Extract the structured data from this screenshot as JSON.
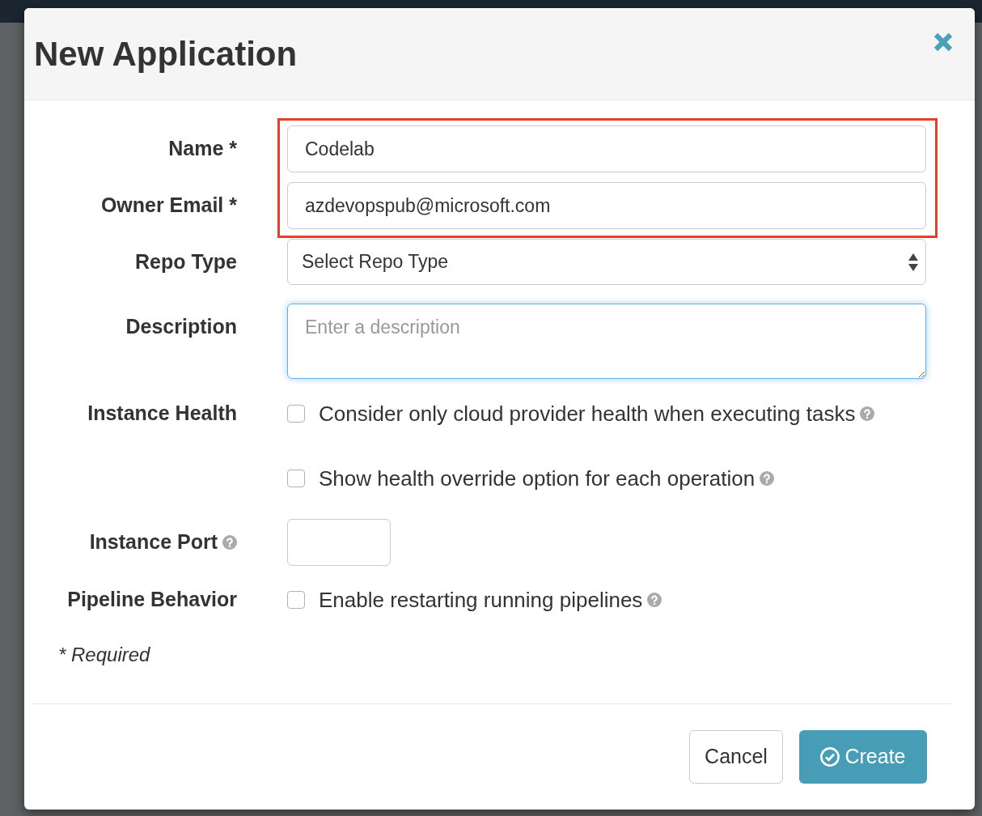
{
  "dialog": {
    "title": "New Application"
  },
  "fields": [
    {
      "kind": "text",
      "label": "Name *",
      "label_help": false,
      "value": "Codelab",
      "focused": false,
      "highlighted": true
    },
    {
      "kind": "text",
      "label": "Owner Email *",
      "label_help": false,
      "value": "azdevopspub@microsoft.com",
      "focused": false,
      "highlighted": true
    },
    {
      "kind": "select",
      "label": "Repo Type",
      "label_help": false,
      "value": "Select Repo Type",
      "focused": false,
      "highlighted": false
    },
    {
      "kind": "textarea",
      "label": "Description",
      "label_help": false,
      "placeholder": "Enter a description",
      "focused": true,
      "highlighted": false
    },
    {
      "kind": "checkboxes",
      "label": "Instance Health",
      "label_help": false,
      "highlighted": false,
      "options": [
        {
          "text": "Consider only cloud provider health when executing tasks",
          "checked": false,
          "help": true
        },
        {
          "text": "Show health override option for each operation",
          "checked": false,
          "help": true
        }
      ]
    },
    {
      "kind": "port",
      "label": "Instance Port",
      "label_help": true,
      "focused": false,
      "highlighted": false
    },
    {
      "kind": "checkboxes",
      "label": "Pipeline Behavior",
      "label_help": false,
      "highlighted": false,
      "options": [
        {
          "text": "Enable restarting running pipelines",
          "checked": false,
          "help": true
        }
      ]
    }
  ],
  "required_note": "* Required",
  "buttons": [
    {
      "kind": "secondary",
      "label": "Cancel"
    },
    {
      "kind": "primary",
      "label": "Create"
    }
  ]
}
